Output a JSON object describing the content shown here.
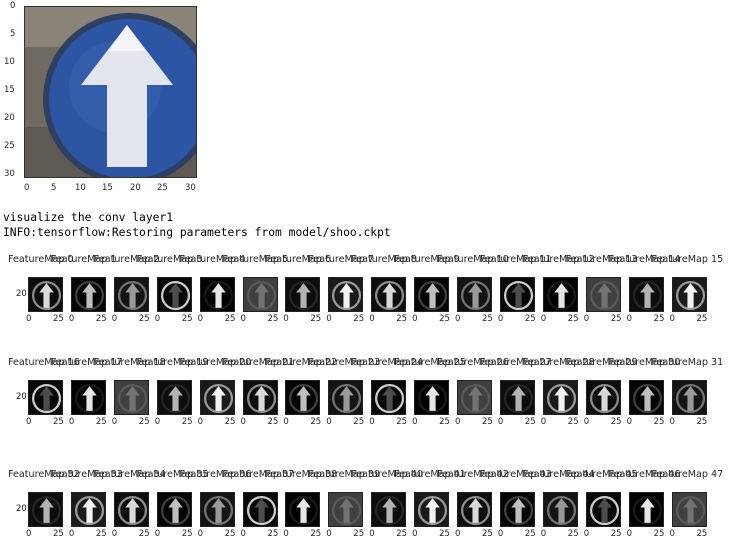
{
  "input_image": {
    "y_ticks": [
      "0",
      "5",
      "10",
      "15",
      "20",
      "25",
      "30"
    ],
    "x_ticks": [
      "0",
      "5",
      "10",
      "15",
      "20",
      "25",
      "30"
    ]
  },
  "output": {
    "line1": "visualize the conv layer1",
    "line2": "INFO:tensorflow:Restoring parameters from model/shoo.ckpt"
  },
  "feature_maps": {
    "rows": [
      {
        "titles": [
          "FeatureMap 0",
          "FeatureMap 1",
          "FeatureMap 2",
          "FeatureMap 3",
          "FeatureMap 4",
          "FeatureMap 5",
          "FeatureMap 6",
          "FeatureMap 7",
          "FeatureMap 8",
          "FeatureMap 9",
          "FeatureMap 10",
          "FeatureMap 11",
          "FeatureMap 12",
          "FeatureMap 13",
          "FeatureMap 14",
          "FeatureMap 15"
        ]
      },
      {
        "titles": [
          "FeatureMap 16",
          "FeatureMap 17",
          "FeatureMap 18",
          "FeatureMap 19",
          "FeatureMap 20",
          "FeatureMap 21",
          "FeatureMap 22",
          "FeatureMap 23",
          "FeatureMap 24",
          "FeatureMap 25",
          "FeatureMap 26",
          "FeatureMap 27",
          "FeatureMap 28",
          "FeatureMap 29",
          "FeatureMap 30",
          "FeatureMap 31"
        ]
      },
      {
        "titles": [
          "FeatureMap 32",
          "FeatureMap 33",
          "FeatureMap 34",
          "FeatureMap 35",
          "FeatureMap 36",
          "FeatureMap 37",
          "FeatureMap 38",
          "FeatureMap 39",
          "FeatureMap 40",
          "FeatureMap 41",
          "FeatureMap 42",
          "FeatureMap 43",
          "FeatureMap 44",
          "FeatureMap 45",
          "FeatureMap 46",
          "FeatureMap 47"
        ]
      }
    ],
    "y_tick": "20",
    "x_tick_left": "0",
    "x_tick_right": "25"
  },
  "colors": {
    "sign_blue": "#2a4f9a",
    "sign_bg": "#7a7469",
    "arrow": "#d8dce4"
  }
}
